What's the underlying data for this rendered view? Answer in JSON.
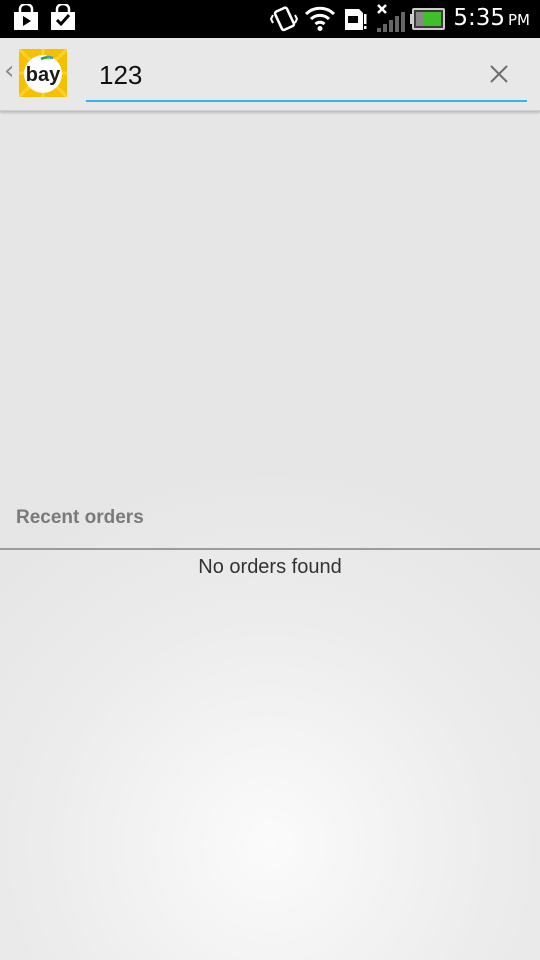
{
  "status_bar": {
    "time": "5:35",
    "ampm": "PM",
    "icons": [
      "play-store-icon",
      "task-check-icon",
      "vibrate-icon",
      "wifi-icon",
      "sd-card-icon",
      "signal-icon",
      "battery-icon"
    ]
  },
  "action_bar": {
    "search": {
      "value": "123",
      "placeholder": ""
    },
    "logo_text": "bay"
  },
  "orders": {
    "section_title": "Recent orders",
    "empty_message": "No orders found"
  },
  "colors": {
    "accent": "#33b5e5",
    "status_bar_bg": "#000000",
    "header_text": "#7a7a7a"
  }
}
